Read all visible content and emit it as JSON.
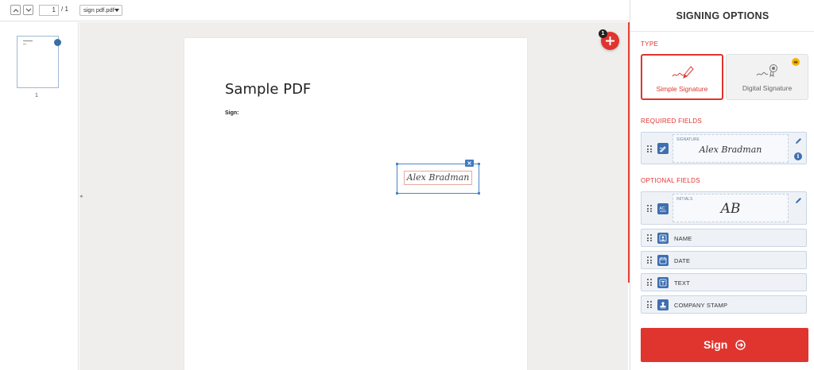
{
  "toolbar": {
    "page_current": "1",
    "page_total": "/ 1",
    "file_name": "sign pdf.pdf"
  },
  "thumbnails": {
    "page_number": "1"
  },
  "document": {
    "title": "Sample PDF",
    "sign_label": "Sign:",
    "placed_signature": "Alex Bradman"
  },
  "add_button": {
    "badge_count": "1"
  },
  "panel": {
    "title": "SIGNING OPTIONS",
    "type_label": "TYPE",
    "types": [
      {
        "label": "Simple Signature",
        "selected": true
      },
      {
        "label": "Digital Signature",
        "selected": false
      }
    ],
    "required_label": "REQUIRED FIELDS",
    "required_fields": [
      {
        "caption": "SIGNATURE",
        "preview": "Alex Bradman",
        "icon": "signature-icon"
      }
    ],
    "optional_label": "OPTIONAL FIELDS",
    "initials": {
      "caption": "INITIALS",
      "preview": "AB",
      "icon": "initials-icon"
    },
    "optional_fields": [
      {
        "label": "NAME",
        "icon": "name-icon"
      },
      {
        "label": "DATE",
        "icon": "date-icon"
      },
      {
        "label": "TEXT",
        "icon": "text-icon"
      },
      {
        "label": "COMPANY STAMP",
        "icon": "stamp-icon"
      }
    ],
    "sign_button": "Sign"
  },
  "colors": {
    "accent": "#e0342e",
    "field_icon": "#3e6fb0",
    "premium": "#f5b400"
  }
}
